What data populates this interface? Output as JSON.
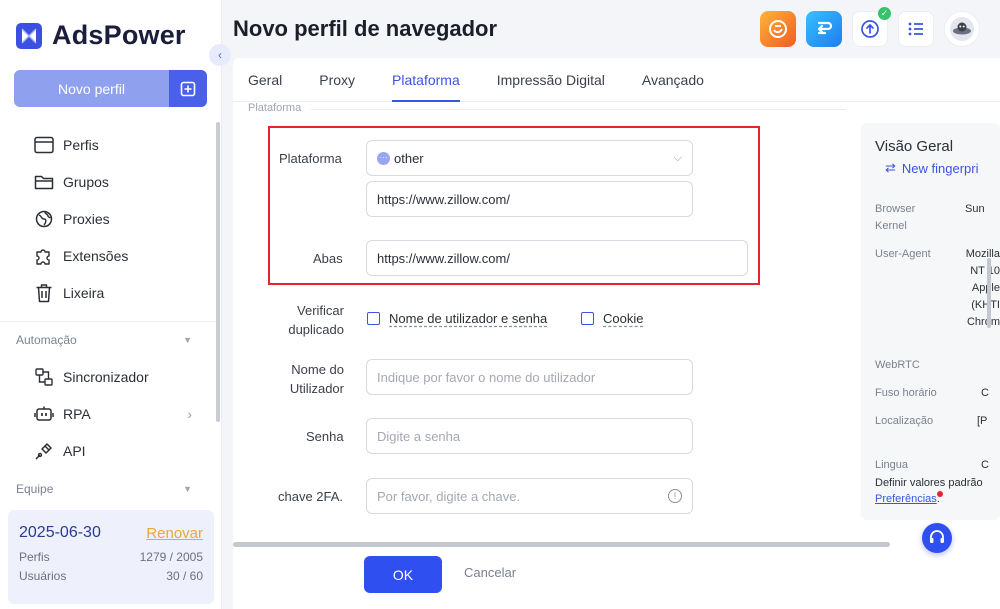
{
  "app": {
    "name": "AdsPower"
  },
  "sidebar": {
    "new_profile_label": "Novo perfil",
    "items": [
      {
        "label": "Perfis",
        "icon": "window-icon"
      },
      {
        "label": "Grupos",
        "icon": "folder-icon"
      },
      {
        "label": "Proxies",
        "icon": "globe-icon"
      },
      {
        "label": "Extensões",
        "icon": "puzzle-icon"
      },
      {
        "label": "Lixeira",
        "icon": "trash-icon"
      }
    ],
    "automation_group": "Automação",
    "automation_items": [
      {
        "label": "Sincronizador",
        "icon": "sync-icon"
      },
      {
        "label": "RPA",
        "icon": "robot-icon"
      },
      {
        "label": "API",
        "icon": "plug-icon"
      }
    ],
    "team_group": "Equipe",
    "subscription": {
      "expiry": "2025-06-30",
      "renew_label": "Renovar",
      "profiles_label": "Perfis",
      "profiles_value": "1279 / 2005",
      "users_label": "Usuários",
      "users_value": "30 / 60"
    }
  },
  "header": {
    "title": "Novo perfil de navegador"
  },
  "tabs": [
    "Geral",
    "Proxy",
    "Plataforma",
    "Impressão Digital",
    "Avançado"
  ],
  "active_tab": "Plataforma",
  "form": {
    "section_label": "Plataforma",
    "platform_label": "Plataforma",
    "platform_value": "other",
    "platform_url": "https://www.zillow.com/",
    "tabs_label": "Abas",
    "tabs_value": "https://www.zillow.com/",
    "verify_label_1": "Verificar",
    "verify_label_2": "duplicado",
    "check_user_pass": "Nome de utilizador e senha",
    "check_cookie": "Cookie",
    "username_label_1": "Nome do",
    "username_label_2": "Utilizador",
    "username_placeholder": "Indique por favor o nome do utilizador",
    "password_label": "Senha",
    "password_placeholder": "Digite a senha",
    "twofa_label": "chave 2FA.",
    "twofa_placeholder": "Por favor, digite a chave."
  },
  "footer": {
    "ok_label": "OK",
    "cancel_label": "Cancelar"
  },
  "overview": {
    "title": "Visão Geral",
    "new_fingerprint": "New fingerpri",
    "browser_kernel_label_1": "Browser",
    "browser_kernel_label_2": "Kernel",
    "browser_kernel_value": "Sun",
    "user_agent_label": "User-Agent",
    "user_agent_lines": [
      "Mozilla",
      "NT 10",
      "Apple",
      "(KHTI",
      "Chrom"
    ],
    "webrtc_label": "WebRTC",
    "timezone_label": "Fuso horário",
    "timezone_value": "C",
    "location_label": "Localização",
    "location_value": "[P",
    "language_label": "Lingua",
    "language_value": "C",
    "footer_text": "Definir valores padrão",
    "footer_link": "Preferências",
    "footer_tail": "."
  },
  "colors": {
    "accent": "#3a54e8",
    "highlight_border": "#e8232b",
    "renew": "#f0a43a"
  }
}
